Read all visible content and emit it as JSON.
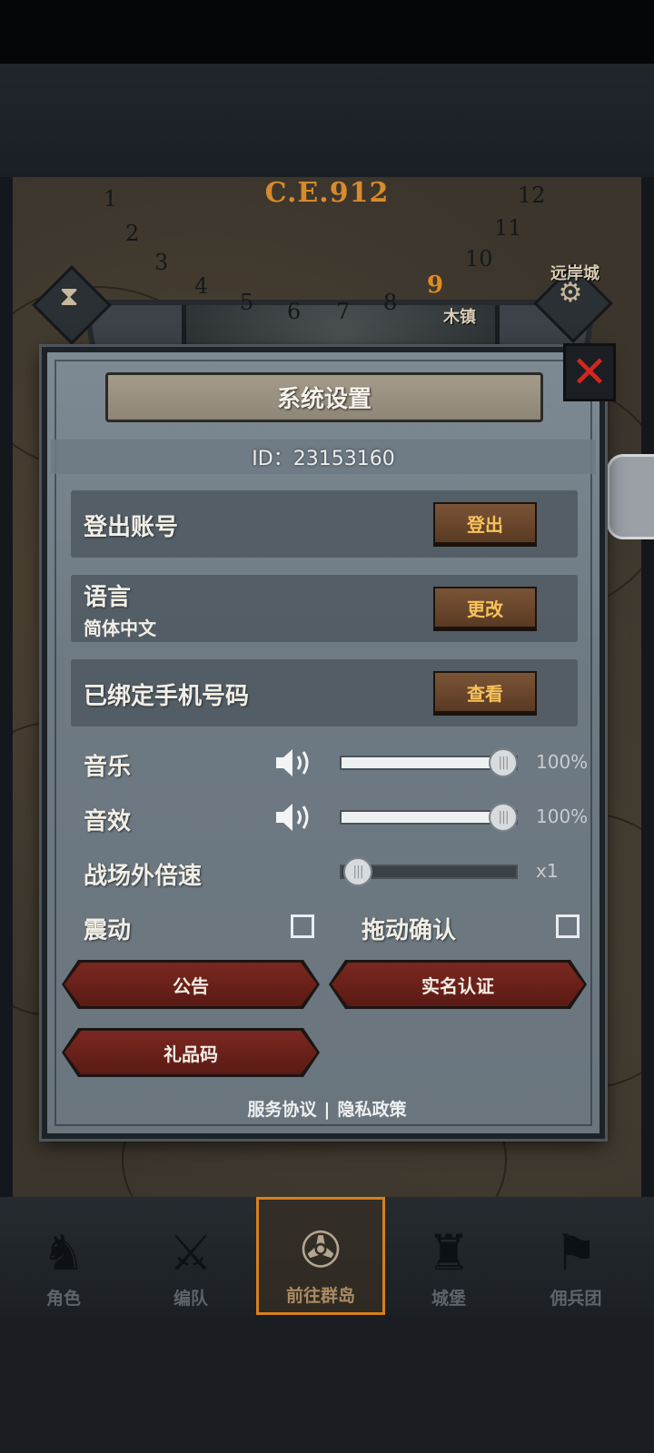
{
  "era": {
    "label": "C.E.912",
    "numbers": [
      "1",
      "2",
      "3",
      "4",
      "5",
      "6",
      "7",
      "8",
      "9",
      "10",
      "11",
      "12"
    ],
    "active": "9"
  },
  "map": {
    "city_far": "远岸城",
    "town_partial": "木镇"
  },
  "dialog": {
    "title": "系统设置",
    "id_text": "ID：23153160",
    "logout": {
      "label": "登出账号",
      "button": "登出"
    },
    "language": {
      "label": "语言",
      "value": "简体中文",
      "button": "更改"
    },
    "phone": {
      "label": "已绑定手机号码",
      "button": "查看"
    },
    "music": {
      "label": "音乐",
      "value_text": "100%",
      "level": 1.0
    },
    "sfx": {
      "label": "音效",
      "value_text": "100%",
      "level": 1.0
    },
    "speed": {
      "label": "战场外倍速",
      "value_text": "x1",
      "level": 0.0
    },
    "vibration": {
      "label": "震动",
      "checked": false
    },
    "drag_confirm": {
      "label": "拖动确认",
      "checked": false
    },
    "buttons": {
      "notice": "公告",
      "realname": "实名认证",
      "giftcode": "礼品码"
    },
    "footer": {
      "service": "服务协议",
      "separator": "|",
      "privacy": "隐私政策"
    }
  },
  "nav": [
    {
      "label": "角色",
      "icon": "knight-helmet-icon"
    },
    {
      "label": "编队",
      "icon": "formation-icon"
    },
    {
      "label": "前往群岛",
      "icon": "compass-icon",
      "active": true
    },
    {
      "label": "城堡",
      "icon": "castle-icon"
    },
    {
      "label": "佣兵团",
      "icon": "mercenary-icon"
    }
  ],
  "colors": {
    "accent_orange": "#d6801f",
    "close_red": "#d4261d",
    "button_gold": "#f7c25a",
    "red_button": "#7a2820"
  }
}
